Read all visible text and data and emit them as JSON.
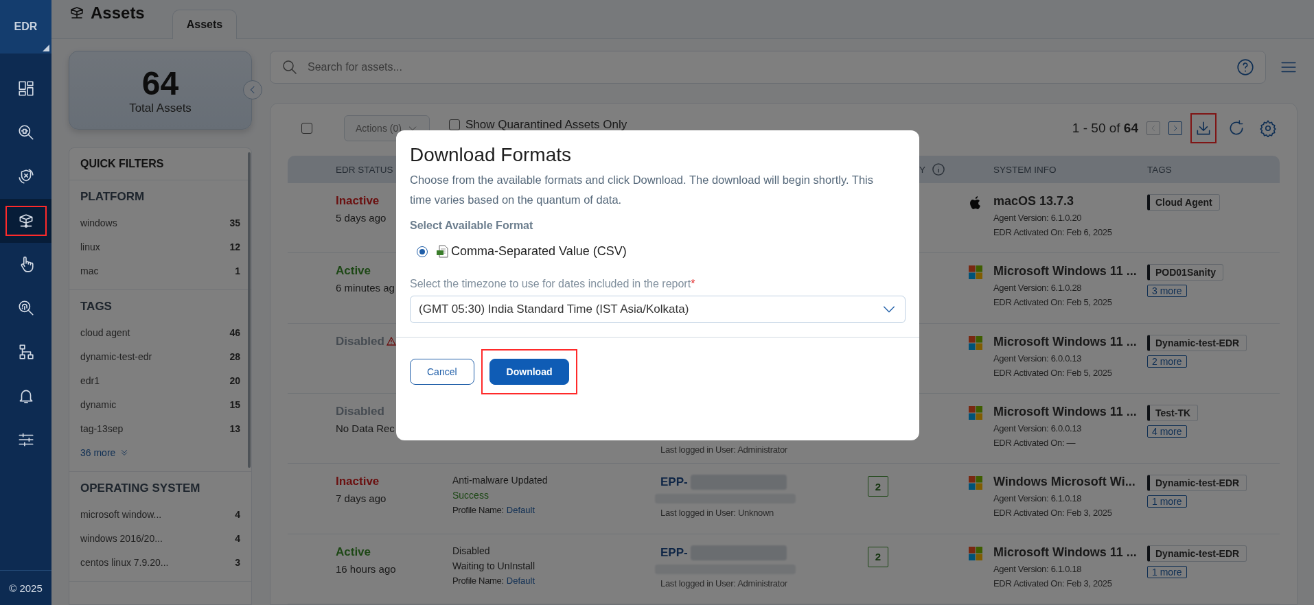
{
  "nav": {
    "logo": "EDR",
    "footer": "© 2025",
    "items": [
      {
        "kind": "dashboard",
        "selected": false
      },
      {
        "kind": "bug-search",
        "selected": false
      },
      {
        "kind": "shield-cycle",
        "selected": false
      },
      {
        "kind": "assets",
        "selected": true
      },
      {
        "kind": "hand",
        "selected": false
      },
      {
        "kind": "fingerprint",
        "selected": false
      },
      {
        "kind": "hierarchy",
        "selected": false
      },
      {
        "kind": "bell",
        "selected": false
      },
      {
        "kind": "sliders",
        "selected": false
      }
    ]
  },
  "header": {
    "title": "Assets",
    "tabs": [
      {
        "label": "Assets",
        "selected": true
      }
    ]
  },
  "summary": {
    "count": "64",
    "label": "Total Assets"
  },
  "quick_filters": {
    "title": "QUICK FILTERS",
    "sections": [
      {
        "title": "PLATFORM",
        "items": [
          {
            "label": "windows",
            "count": "35"
          },
          {
            "label": "linux",
            "count": "12"
          },
          {
            "label": "mac",
            "count": "1"
          }
        ]
      },
      {
        "title": "TAGS",
        "items": [
          {
            "label": "cloud agent",
            "count": "46"
          },
          {
            "label": "dynamic-test-edr",
            "count": "28"
          },
          {
            "label": "edr1",
            "count": "20"
          },
          {
            "label": "dynamic",
            "count": "15"
          },
          {
            "label": "tag-13sep",
            "count": "13"
          }
        ],
        "more": "36 more"
      },
      {
        "title": "OPERATING SYSTEM",
        "items": [
          {
            "label": "microsoft window...",
            "count": "4"
          },
          {
            "label": "windows 2016/20...",
            "count": "4"
          },
          {
            "label": "centos linux 7.9.20...",
            "count": "3"
          }
        ]
      }
    ]
  },
  "search": {
    "placeholder": "Search for assets..."
  },
  "toolbar": {
    "select_all_checked": false,
    "actions": "Actions (0)",
    "quarantine": {
      "label": "Show Quarantined Assets Only",
      "checked": false
    },
    "range": "1 - 50 of",
    "total": "64",
    "prev_disabled": true,
    "next_disabled": false,
    "icons": [
      {
        "kind": "download",
        "highlighted": true
      },
      {
        "kind": "refresh",
        "highlighted": false
      },
      {
        "kind": "settings",
        "highlighted": false
      }
    ]
  },
  "table": {
    "columns": [
      {
        "label": "EDR STATUS",
        "info": false
      },
      {
        "label": "Y",
        "info": true
      },
      {
        "label": "SYSTEM INFO",
        "info": false
      },
      {
        "label": "TAGS",
        "info": false
      }
    ],
    "rows": [
      {
        "status": {
          "text": "Inactive",
          "kind": "inactive"
        },
        "time": "5 days ago",
        "warning": false,
        "os": {
          "kind": "apple",
          "name": "macOS 13.7.3"
        },
        "agent": "Agent Version: 6.1.0.20",
        "activated": "EDR Activated On:  Feb 6, 2025",
        "tag": "Cloud Agent"
      },
      {
        "status": {
          "text": "Active",
          "kind": "active"
        },
        "time": "6 minutes ag",
        "warning": false,
        "os": {
          "kind": "windows",
          "name": "Microsoft Windows 11 ..."
        },
        "agent": "Agent Version: 6.1.0.28",
        "activated": "EDR Activated On:  Feb 5, 2025",
        "tag": "POD01Sanity",
        "more": "3 more"
      },
      {
        "status": {
          "text": "Disabled",
          "kind": "disabled"
        },
        "warning": true,
        "os": {
          "kind": "windows",
          "name": "Microsoft Windows 11 ..."
        },
        "agent": "Agent Version: 6.0.0.13",
        "activated": "EDR Activated On:  Feb 5, 2025",
        "tag": "Dynamic-test-EDR",
        "more": "2 more"
      },
      {
        "status": {
          "text": "Disabled",
          "kind": "disabled"
        },
        "time": "No Data Rec",
        "warning": false,
        "user": "Last logged in User: Administrator",
        "os": {
          "kind": "windows",
          "name": "Microsoft Windows 11 ..."
        },
        "agent": "Agent Version: 6.0.0.13",
        "activated": "EDR Activated On:  —",
        "tag": "Test-TK",
        "more": "4 more"
      },
      {
        "status": {
          "text": "Inactive",
          "kind": "inactive"
        },
        "time": "7 days ago",
        "warning": false,
        "protection": [
          {
            "text": "Anti-malware Updated",
            "kind": "plain"
          },
          {
            "text": "Success",
            "kind": "success"
          }
        ],
        "profile_label": "Profile Name:",
        "profile": "Default",
        "endpoint": "EPP-",
        "user": "Last logged in User: Unknown",
        "count": "2",
        "os": {
          "kind": "windows",
          "name": "Windows Microsoft Wi..."
        },
        "agent": "Agent Version: 6.1.0.18",
        "activated": "EDR Activated On:  Feb 3, 2025",
        "tag": "Dynamic-test-EDR",
        "more": "1 more"
      },
      {
        "status": {
          "text": "Active",
          "kind": "active"
        },
        "time": "16 hours ago",
        "warning": false,
        "protection": [
          {
            "text": "Disabled",
            "kind": "plain"
          },
          {
            "text": "Waiting to UnInstall",
            "kind": "plain"
          }
        ],
        "profile_label": "Profile Name:",
        "profile": "Default",
        "endpoint": "EPP-",
        "user": "Last logged in User: Administrator",
        "count": "2",
        "os": {
          "kind": "windows",
          "name": "Microsoft Windows 11 ..."
        },
        "agent": "Agent Version: 6.1.0.18",
        "activated": "EDR Activated On:  Feb 3, 2025",
        "tag": "Dynamic-test-EDR",
        "more": "1 more"
      }
    ]
  },
  "dialog": {
    "title": "Download Formats",
    "description": "Choose from the available formats and click Download. The download will begin shortly. This time varies based on the quantum of data.",
    "format_heading": "Select Available Format",
    "formats": [
      {
        "label": "Comma-Separated Value (CSV)",
        "selected": true
      }
    ],
    "timezone_label": "Select the timezone to use for dates included in the report",
    "required_mark": "*",
    "timezone": "(GMT 05:30) India Standard Time (IST Asia/Kolkata)",
    "buttons": [
      {
        "label": "Cancel",
        "kind": "secondary",
        "highlighted": false
      },
      {
        "label": "Download",
        "kind": "primary",
        "highlighted": true
      }
    ]
  }
}
